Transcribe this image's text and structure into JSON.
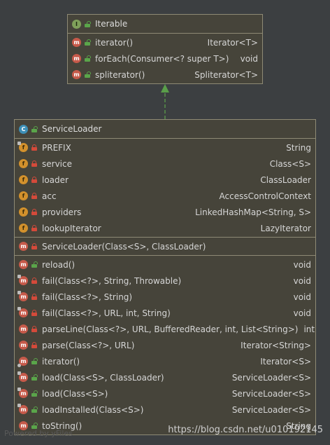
{
  "iterable": {
    "header": {
      "badge": "I",
      "title": "Iterable"
    },
    "methods": [
      {
        "badge": "m",
        "name": "iterator()",
        "type": "Iterator<T>"
      },
      {
        "badge": "m",
        "name": "forEach(Consumer<? super T>)",
        "type": "void"
      },
      {
        "badge": "m",
        "name": "spliterator()",
        "type": "Spliterator<T>"
      }
    ]
  },
  "service_loader": {
    "header": {
      "badge": "C",
      "title": "ServiceLoader"
    },
    "fields": [
      {
        "badge": "f",
        "name": "PREFIX",
        "type": "String"
      },
      {
        "badge": "f",
        "name": "service",
        "type": "Class<S>"
      },
      {
        "badge": "f",
        "name": "loader",
        "type": "ClassLoader"
      },
      {
        "badge": "f",
        "name": "acc",
        "type": "AccessControlContext"
      },
      {
        "badge": "f",
        "name": "providers",
        "type": "LinkedHashMap<String, S>"
      },
      {
        "badge": "f",
        "name": "lookupIterator",
        "type": "LazyIterator"
      }
    ],
    "constructors": [
      {
        "badge": "m",
        "name": "ServiceLoader(Class<S>, ClassLoader)",
        "type": ""
      }
    ],
    "methods": [
      {
        "badge": "m",
        "name": "reload()",
        "type": "void"
      },
      {
        "badge": "m",
        "name": "fail(Class<?>, String, Throwable)",
        "type": "void"
      },
      {
        "badge": "m",
        "name": "fail(Class<?>, String)",
        "type": "void"
      },
      {
        "badge": "m",
        "name": "fail(Class<?>, URL, int, String)",
        "type": "void"
      },
      {
        "badge": "m",
        "name": "parseLine(Class<?>, URL, BufferedReader, int, List<String>)",
        "type": "int"
      },
      {
        "badge": "m",
        "name": "parse(Class<?>, URL)",
        "type": "Iterator<String>"
      },
      {
        "badge": "m",
        "name": "iterator()",
        "type": "Iterator<S>"
      },
      {
        "badge": "m",
        "name": "load(Class<S>, ClassLoader)",
        "type": "ServiceLoader<S>"
      },
      {
        "badge": "m",
        "name": "load(Class<S>)",
        "type": "ServiceLoader<S>"
      },
      {
        "badge": "m",
        "name": "loadInstalled(Class<S>)",
        "type": "ServiceLoader<S>"
      },
      {
        "badge": "m",
        "name": "toString()",
        "type": "String"
      }
    ]
  },
  "footer": {
    "watermark": "Powered by yFiles",
    "csdn_url": "https://blog.csdn.net/u010192145"
  },
  "colors": {
    "background": "#3c3f41",
    "box_fill": "#46443a",
    "box_border": "#8e8a75",
    "arrow": "#5a9e4a"
  }
}
